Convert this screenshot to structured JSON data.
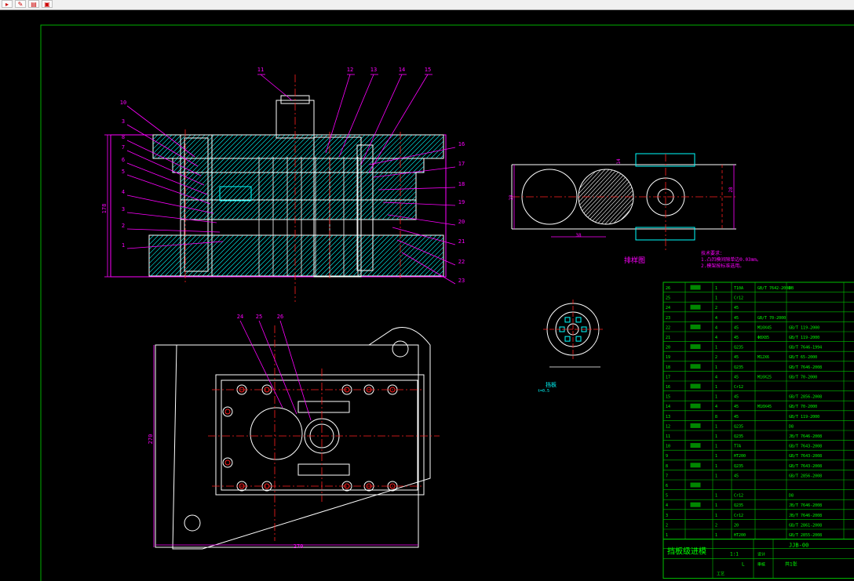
{
  "toolbar": {
    "tools": [
      {
        "icon": "toolbar-arrow-icon",
        "label": "▸"
      },
      {
        "icon": "toolbar-edit-icon",
        "label": "✎"
      },
      {
        "icon": "toolbar-layer-icon",
        "label": "▤"
      },
      {
        "icon": "toolbar-image-icon",
        "label": "▣"
      }
    ]
  },
  "colors": {
    "frame": "#00b000",
    "leader": "#ff00ff",
    "centerline": "#ff2020",
    "outline": "#ffffff",
    "hatch": "#00ffff",
    "dim": "#ff00ff",
    "table_line": "#00c000",
    "table_text": "#00ff00",
    "table_fill": "#008800",
    "text_white": "#ffffff"
  },
  "section_view": {
    "dim_height": "178",
    "callouts_top": [
      "11",
      "12",
      "13",
      "14",
      "15"
    ],
    "callouts_left": [
      "10",
      "3",
      "8",
      "7",
      "6",
      "5",
      "4",
      "3",
      "2",
      "1"
    ],
    "callouts_right": [
      "16",
      "17",
      "18",
      "19",
      "20",
      "21",
      "22",
      "23"
    ]
  },
  "plan_view": {
    "callouts": [
      "24",
      "25",
      "26"
    ],
    "dim_width": "270",
    "dim_height": "270"
  },
  "strip_view": {
    "title": "排样图",
    "dim_left": "28",
    "dim_right": "28",
    "dim_pitch": "38",
    "dim_small": "14",
    "notes": [
      "技术要求：",
      "1.凸凹模间隙单边0.03mm。",
      "2.模架按标准选用。"
    ]
  },
  "part_view": {
    "caption": "挡板",
    "subcaption": "t=0.5"
  },
  "bom": {
    "rows": [
      [
        "26",
        "",
        "1",
        "T10A",
        "GB/T 7642-2008",
        "DB"
      ],
      [
        "25",
        "",
        "1",
        "Cr12",
        "",
        ""
      ],
      [
        "24",
        "",
        "2",
        "45",
        "",
        ""
      ],
      [
        "23",
        "",
        "4",
        "45",
        "GB/T 70-2000",
        ""
      ],
      [
        "22",
        "",
        "4",
        "45",
        "M10X45",
        "GB/T 119-2000"
      ],
      [
        "21",
        "",
        "4",
        "45",
        "Φ8X85",
        "GB/T 119-2000"
      ],
      [
        "20",
        "",
        "1",
        "Q235",
        "",
        "GB/T 7646-1994"
      ],
      [
        "19",
        "",
        "2",
        "45",
        "M12X6",
        "GB/T 65-2000"
      ],
      [
        "18",
        "",
        "1",
        "Q235",
        "",
        "GB/T 7646-2008"
      ],
      [
        "17",
        "",
        "4",
        "45",
        "M10X25",
        "GB/T 70-2000"
      ],
      [
        "16",
        "",
        "1",
        "Cr12",
        "",
        ""
      ],
      [
        "15",
        "",
        "1",
        "45",
        "",
        "GB/T 2856-2008"
      ],
      [
        "14",
        "",
        "4",
        "45",
        "M10X45",
        "GB/T 70-2000"
      ],
      [
        "13",
        "",
        "8",
        "45",
        "",
        "GB/T 119-2000"
      ],
      [
        "12",
        "",
        "1",
        "Q235",
        "",
        "D8"
      ],
      [
        "11",
        "",
        "1",
        "Q235",
        "",
        "JB/T 7646-2008"
      ],
      [
        "10",
        "",
        "1",
        "T7A",
        "",
        "GB/T 7643-2008"
      ],
      [
        "9",
        "",
        "1",
        "HT200",
        "",
        "GB/T 7643-2008"
      ],
      [
        "8",
        "",
        "1",
        "Q235",
        "",
        "GB/T 7643-2008"
      ],
      [
        "7",
        "",
        "1",
        "45",
        "",
        "GB/T 2856-2008"
      ],
      [
        "6",
        "",
        "",
        "",
        "",
        ""
      ],
      [
        "5",
        "",
        "1",
        "Cr12",
        "",
        "D8"
      ],
      [
        "4",
        "",
        "1",
        "Q235",
        "",
        "JB/T 7646-2008"
      ],
      [
        "3",
        "",
        "1",
        "Cr12",
        "",
        "JB/T 7646-2008"
      ],
      [
        "2",
        "",
        "2",
        "20",
        "",
        "GB/T 2861-2008"
      ],
      [
        "1",
        "",
        "1",
        "HT200",
        "",
        "GB/T 2855-2008"
      ]
    ],
    "title_left": "挡板级进模",
    "drawing_no": "JJB-00",
    "scale_val": "1:1",
    "sheet": "共1张",
    "row_l": "L",
    "labels": [
      "工艺",
      "设计",
      "审核"
    ]
  }
}
